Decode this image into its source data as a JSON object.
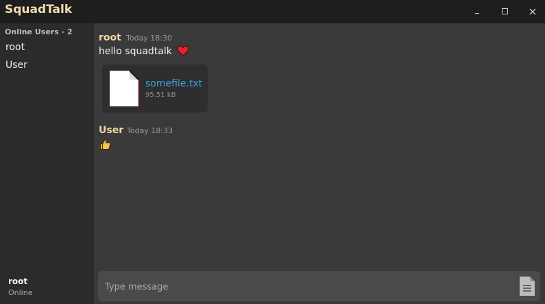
{
  "app": {
    "title": "SquadTalk",
    "accent_color": "#f4dfb0",
    "window_controls": [
      "minimize-icon",
      "maximize-icon",
      "close-icon"
    ]
  },
  "sidebar": {
    "header": "Online Users - 2",
    "users": [
      "root",
      "User"
    ],
    "current_user": {
      "name": "root",
      "status": "Online"
    }
  },
  "messages": [
    {
      "author": "root",
      "time": "Today 18:30",
      "text": "hello squadtalk",
      "emoji": "heart-icon",
      "attachment": {
        "name": "somefile.txt",
        "size": "95.51 kB",
        "icon": "file-icon"
      }
    },
    {
      "author": "User",
      "time": "Today 18:33",
      "emoji": "thumbs-up-icon"
    }
  ],
  "composer": {
    "placeholder": "Type message",
    "value": "",
    "attach_icon": "document-icon"
  }
}
